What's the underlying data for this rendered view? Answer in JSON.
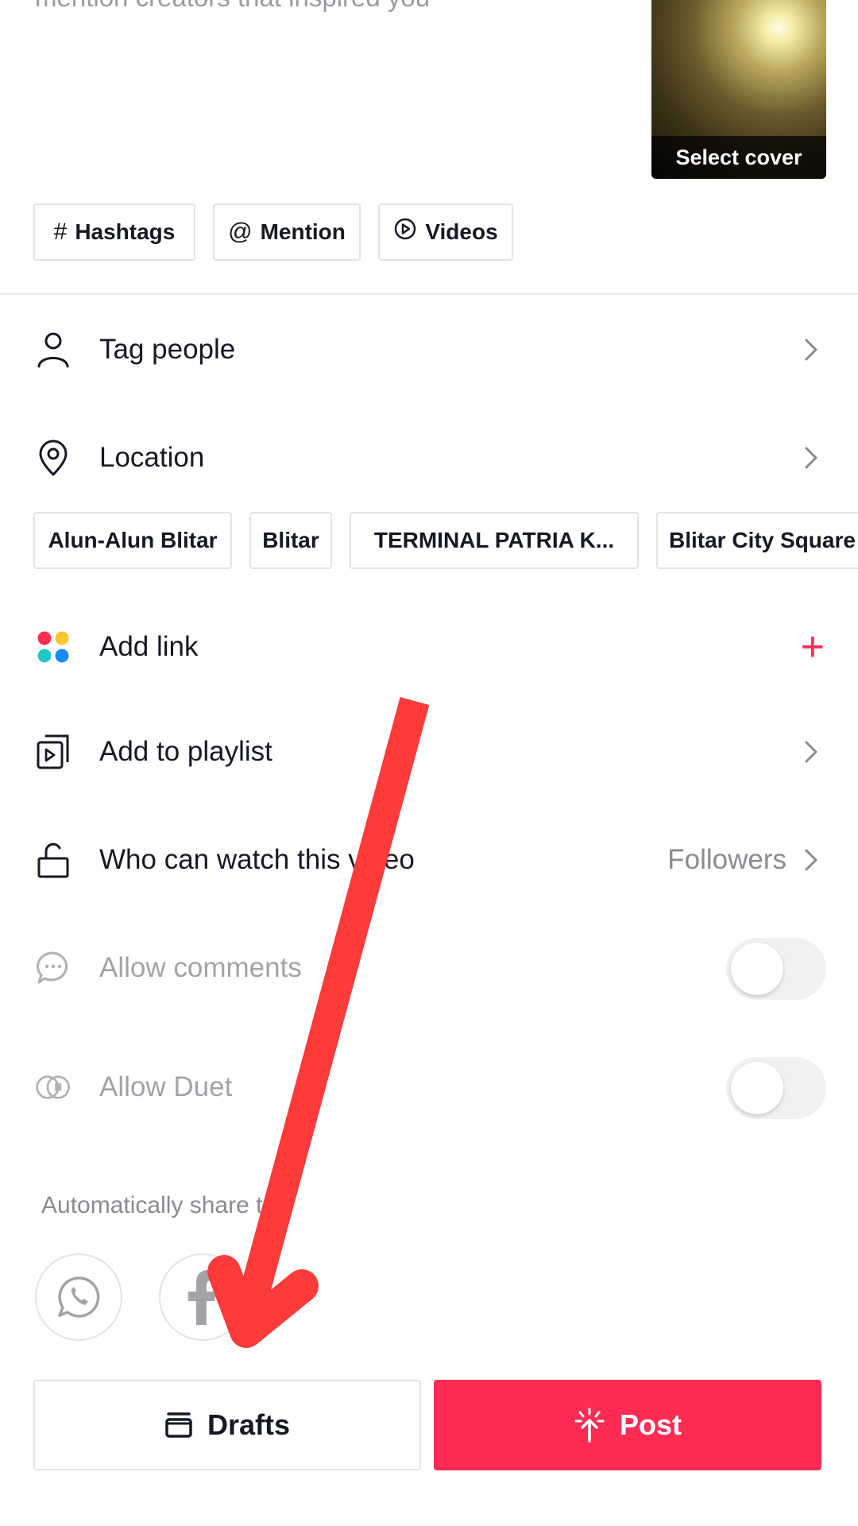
{
  "caption": {
    "hint": "mention creators that inspired you"
  },
  "cover": {
    "label": "Select cover"
  },
  "chips": [
    {
      "icon": "#",
      "label": "Hashtags"
    },
    {
      "icon": "@",
      "label": "Mention"
    },
    {
      "icon": "▷",
      "label": "Videos"
    }
  ],
  "tag_people": {
    "label": "Tag people"
  },
  "location": {
    "label": "Location",
    "suggestions": [
      "Alun-Alun Blitar",
      "Blitar",
      "TERMINAL PATRIA K...",
      "Blitar City Square"
    ]
  },
  "add_link": {
    "label": "Add link",
    "action": "+"
  },
  "add_to_playlist": {
    "label": "Add to playlist"
  },
  "who_can_watch": {
    "label": "Who can watch this video",
    "value": "Followers"
  },
  "allow_comments": {
    "label": "Allow comments",
    "enabled": false
  },
  "allow_duet": {
    "label": "Allow Duet",
    "enabled": false
  },
  "share": {
    "title": "Automatically share to:",
    "targets": [
      "whatsapp-icon",
      "facebook-icon"
    ]
  },
  "buttons": {
    "drafts": "Drafts",
    "post": "Post"
  },
  "colors": {
    "accent": "#fe2c55",
    "annotation_arrow": "#fe3b3b",
    "text": "#161823",
    "muted": "#8a8b91"
  }
}
